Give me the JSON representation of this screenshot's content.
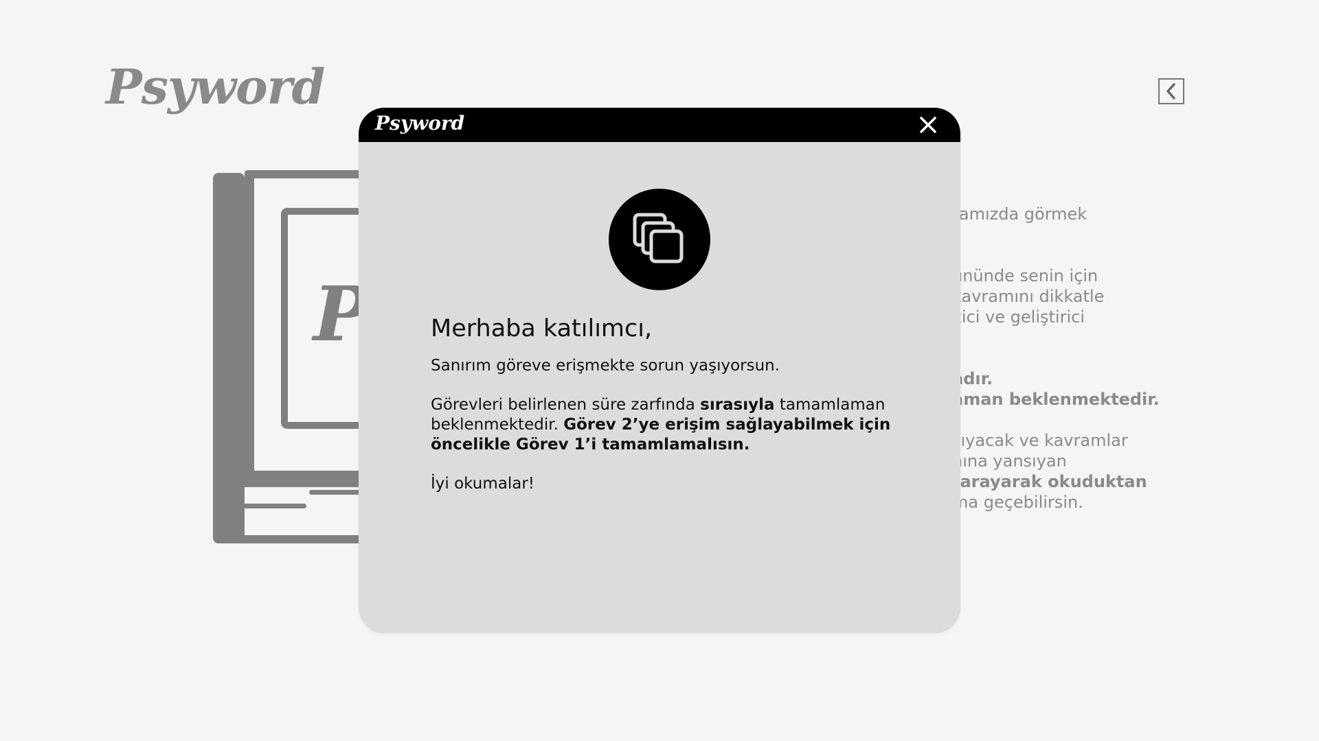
{
  "app": {
    "logo": "Psyword",
    "back_icon": "chevron-left-icon"
  },
  "background": {
    "book_logo_letter": "P",
    "lines": [
      "ramızda görmek",
      "ününde senin için",
      "kavramını dikkatle",
      "kici ve geliştirici",
      "adır.",
      "aman beklenmektedir.",
      "sıyacak ve kavramlar",
      "nına yansıyan",
      "tarayarak okuduktan",
      "ma geçebilirsin."
    ]
  },
  "modal": {
    "logo": "Psyword",
    "close_icon": "close-icon",
    "center_icon": "copy-icon",
    "greeting": "Merhaba katılımcı,",
    "line1": "Sanırım göreve erişmekte sorun yaşıyorsun.",
    "p2_part1": "Görevleri belirlenen süre zarfında ",
    "p2_bold1": "sırasıyla",
    "p2_part2": " tamamlaman beklenmektedir. ",
    "p2_bold2": "Görev 2’ye erişim sağlayabilmek için öncelikle Görev 1’i tamamlamalısın.",
    "closing": "İyi okumalar!"
  },
  "colors": {
    "page_bg": "#f5f5f5",
    "modal_bg": "#dcdcdc",
    "modal_header": "#000000",
    "muted_gray": "#8a8a8a"
  }
}
